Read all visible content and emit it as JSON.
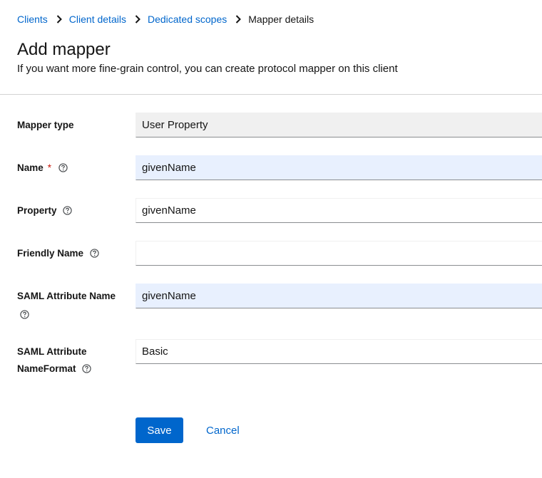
{
  "breadcrumb": {
    "items": [
      "Clients",
      "Client details",
      "Dedicated scopes"
    ],
    "current": "Mapper details"
  },
  "header": {
    "title": "Add mapper",
    "subtitle": "If you want more fine-grain control, you can create protocol mapper on this client"
  },
  "form": {
    "mapper_type": {
      "label": "Mapper type",
      "value": "User Property"
    },
    "name": {
      "label": "Name",
      "required_marker": "*",
      "value": "givenName"
    },
    "property": {
      "label": "Property",
      "value": "givenName"
    },
    "friendly_name": {
      "label": "Friendly Name",
      "value": ""
    },
    "saml_attribute_name": {
      "label": "SAML Attribute Name",
      "value": "givenName"
    },
    "saml_attribute_nameformat": {
      "label_line1": "SAML Attribute",
      "label_line2": "NameFormat",
      "value": "Basic"
    }
  },
  "actions": {
    "save_label": "Save",
    "cancel_label": "Cancel"
  },
  "icons": {
    "breadcrumb_separator": "chevron-right-icon",
    "help": "help-circle-icon"
  },
  "colors": {
    "link": "#0066cc",
    "primary_button": "#0066cc",
    "required": "#c9190b",
    "autofill_background": "#e8f0fe",
    "readonly_background": "#f0f0f0"
  }
}
